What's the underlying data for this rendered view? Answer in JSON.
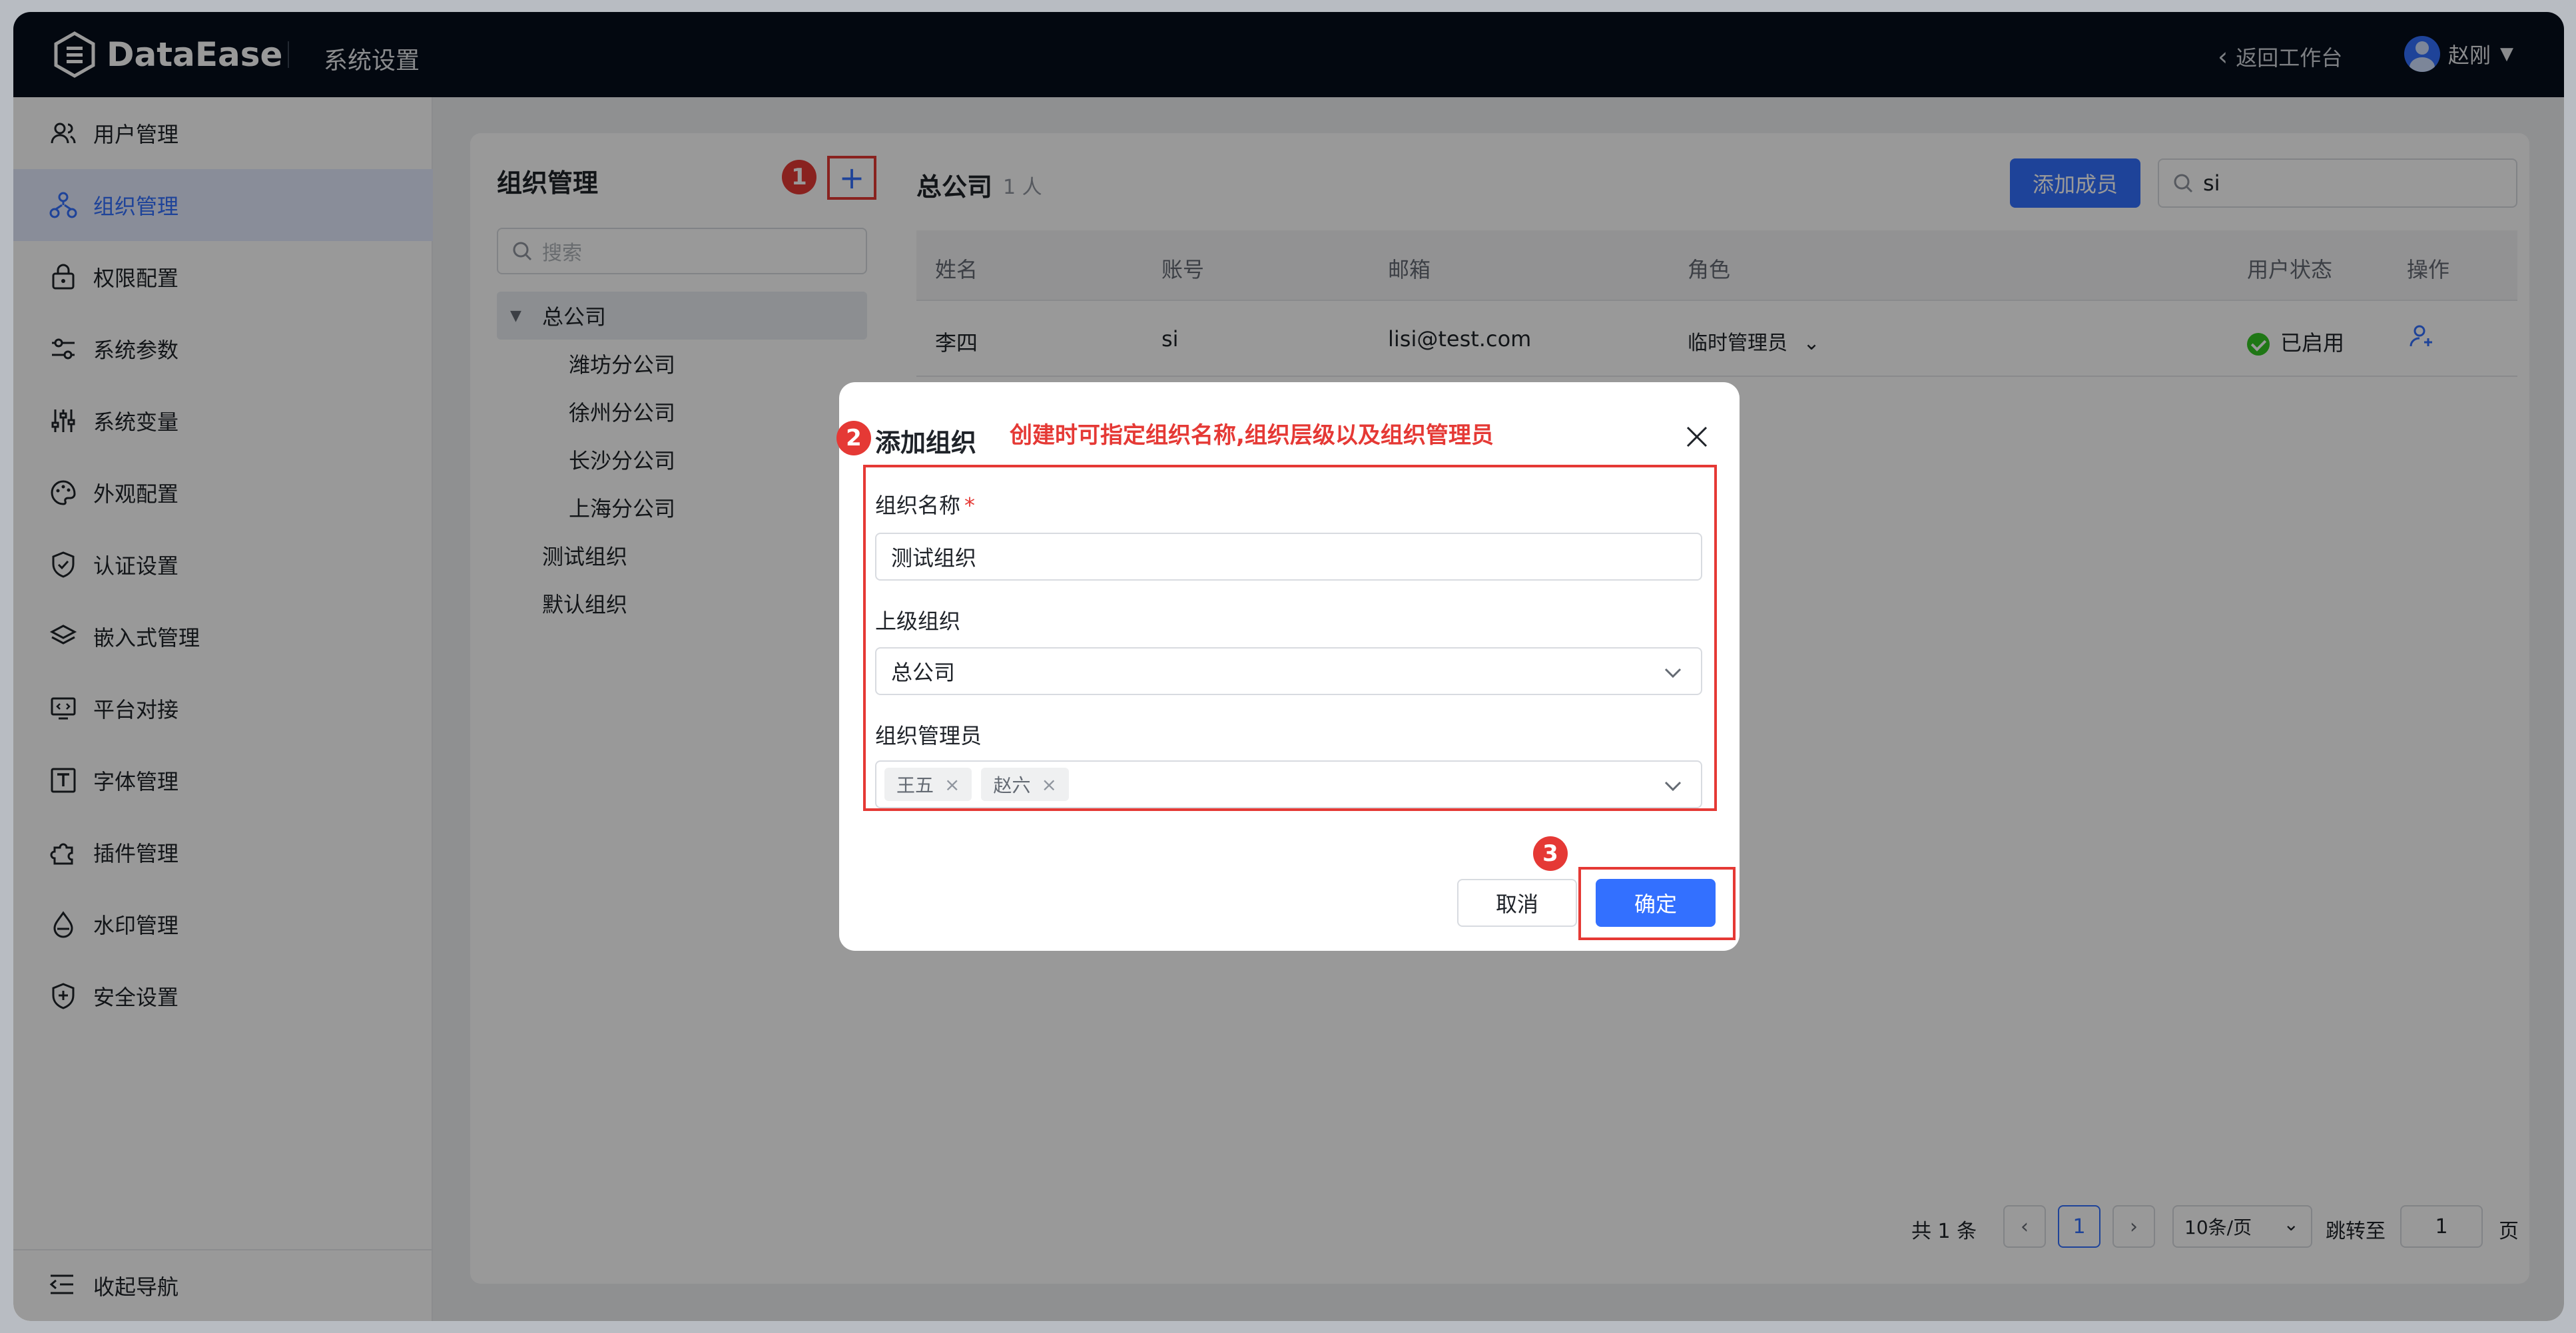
{
  "header": {
    "logo_text": "DataEase",
    "section_title": "系统设置",
    "back_label": "返回工作台",
    "user_name": "赵刚"
  },
  "sidebar": {
    "items": [
      {
        "label": "用户管理",
        "icon": "users-icon"
      },
      {
        "label": "组织管理",
        "icon": "org-tree-icon",
        "active": true
      },
      {
        "label": "权限配置",
        "icon": "lock-icon"
      },
      {
        "label": "系统参数",
        "icon": "sliders-icon"
      },
      {
        "label": "系统变量",
        "icon": "variables-icon"
      },
      {
        "label": "外观配置",
        "icon": "palette-icon"
      },
      {
        "label": "认证设置",
        "icon": "shield-check-icon"
      },
      {
        "label": "嵌入式管理",
        "icon": "layers-icon"
      },
      {
        "label": "平台对接",
        "icon": "monitor-code-icon"
      },
      {
        "label": "字体管理",
        "icon": "font-icon"
      },
      {
        "label": "插件管理",
        "icon": "plugin-icon"
      },
      {
        "label": "水印管理",
        "icon": "drop-icon"
      },
      {
        "label": "安全设置",
        "icon": "shield-plus-icon"
      }
    ],
    "collapse_label": "收起导航"
  },
  "org_panel": {
    "title": "组织管理",
    "search_placeholder": "搜索",
    "tree": [
      {
        "label": "总公司",
        "level": 0,
        "expanded": true,
        "selected": true
      },
      {
        "label": "潍坊分公司",
        "level": 1
      },
      {
        "label": "徐州分公司",
        "level": 1
      },
      {
        "label": "长沙分公司",
        "level": 1
      },
      {
        "label": "上海分公司",
        "level": 1
      },
      {
        "label": "测试组织",
        "level": 0
      },
      {
        "label": "默认组织",
        "level": 0
      }
    ]
  },
  "members": {
    "org_name": "总公司",
    "count_label": "1 人",
    "add_label": "添加成员",
    "search_value": "si",
    "columns": [
      "姓名",
      "账号",
      "邮箱",
      "角色",
      "用户状态",
      "操作"
    ],
    "rows": [
      {
        "name": "李四",
        "account": "si",
        "email": "lisi@test.com",
        "role": "临时管理员",
        "status": "已启用"
      }
    ]
  },
  "pagination": {
    "total_label": "共 1 条",
    "current_page": "1",
    "page_size": "10条/页",
    "jump_label": "跳转至",
    "jump_value": "1",
    "page_unit": "页"
  },
  "modal": {
    "title": "添加组织",
    "annotation": "创建时可指定组织名称,组织层级以及组织管理员",
    "name_label": "组织名称",
    "required_mark": "*",
    "name_value": "测试组织",
    "parent_label": "上级组织",
    "parent_value": "总公司",
    "admin_label": "组织管理员",
    "admin_tags": [
      "王五",
      "赵六"
    ],
    "cancel_label": "取消",
    "ok_label": "确定"
  },
  "step_badges": [
    "1",
    "2",
    "3"
  ],
  "colors": {
    "brand": "#3370ff",
    "header_bg": "#050e1c",
    "annotation_red": "#e53935",
    "status_green": "#34c724"
  }
}
